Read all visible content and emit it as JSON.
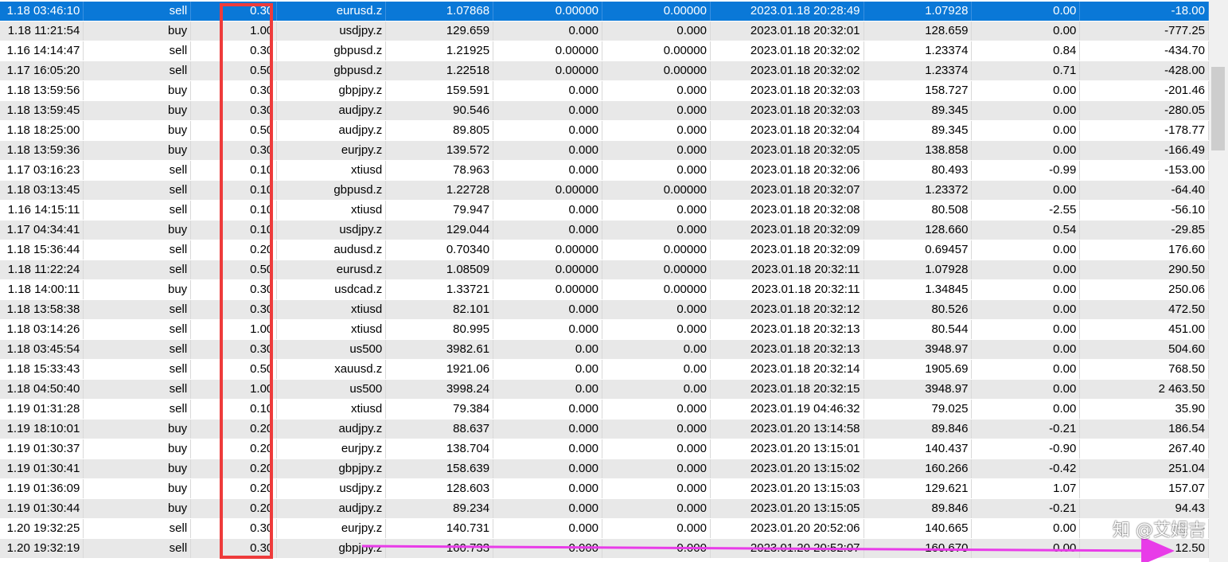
{
  "table": {
    "rows": [
      {
        "open_time": "1.18 03:46:10",
        "type": "sell",
        "volume": "0.30",
        "symbol": "eurusd.z",
        "price": "1.07868",
        "sl": "0.00000",
        "tp": "0.00000",
        "close_time": "2023.01.18 20:28:49",
        "close_price": "1.07928",
        "swap": "0.00",
        "profit": "-18.00"
      },
      {
        "open_time": "1.18 11:21:54",
        "type": "buy",
        "volume": "1.00",
        "symbol": "usdjpy.z",
        "price": "129.659",
        "sl": "0.000",
        "tp": "0.000",
        "close_time": "2023.01.18 20:32:01",
        "close_price": "128.659",
        "swap": "0.00",
        "profit": "-777.25"
      },
      {
        "open_time": "1.16 14:14:47",
        "type": "sell",
        "volume": "0.30",
        "symbol": "gbpusd.z",
        "price": "1.21925",
        "sl": "0.00000",
        "tp": "0.00000",
        "close_time": "2023.01.18 20:32:02",
        "close_price": "1.23374",
        "swap": "0.84",
        "profit": "-434.70"
      },
      {
        "open_time": "1.17 16:05:20",
        "type": "sell",
        "volume": "0.50",
        "symbol": "gbpusd.z",
        "price": "1.22518",
        "sl": "0.00000",
        "tp": "0.00000",
        "close_time": "2023.01.18 20:32:02",
        "close_price": "1.23374",
        "swap": "0.71",
        "profit": "-428.00"
      },
      {
        "open_time": "1.18 13:59:56",
        "type": "buy",
        "volume": "0.30",
        "symbol": "gbpjpy.z",
        "price": "159.591",
        "sl": "0.000",
        "tp": "0.000",
        "close_time": "2023.01.18 20:32:03",
        "close_price": "158.727",
        "swap": "0.00",
        "profit": "-201.46"
      },
      {
        "open_time": "1.18 13:59:45",
        "type": "buy",
        "volume": "0.30",
        "symbol": "audjpy.z",
        "price": "90.546",
        "sl": "0.000",
        "tp": "0.000",
        "close_time": "2023.01.18 20:32:03",
        "close_price": "89.345",
        "swap": "0.00",
        "profit": "-280.05"
      },
      {
        "open_time": "1.18 18:25:00",
        "type": "buy",
        "volume": "0.50",
        "symbol": "audjpy.z",
        "price": "89.805",
        "sl": "0.000",
        "tp": "0.000",
        "close_time": "2023.01.18 20:32:04",
        "close_price": "89.345",
        "swap": "0.00",
        "profit": "-178.77"
      },
      {
        "open_time": "1.18 13:59:36",
        "type": "buy",
        "volume": "0.30",
        "symbol": "eurjpy.z",
        "price": "139.572",
        "sl": "0.000",
        "tp": "0.000",
        "close_time": "2023.01.18 20:32:05",
        "close_price": "138.858",
        "swap": "0.00",
        "profit": "-166.49"
      },
      {
        "open_time": "1.17 03:16:23",
        "type": "sell",
        "volume": "0.10",
        "symbol": "xtiusd",
        "price": "78.963",
        "sl": "0.000",
        "tp": "0.000",
        "close_time": "2023.01.18 20:32:06",
        "close_price": "80.493",
        "swap": "-0.99",
        "profit": "-153.00"
      },
      {
        "open_time": "1.18 03:13:45",
        "type": "sell",
        "volume": "0.10",
        "symbol": "gbpusd.z",
        "price": "1.22728",
        "sl": "0.00000",
        "tp": "0.00000",
        "close_time": "2023.01.18 20:32:07",
        "close_price": "1.23372",
        "swap": "0.00",
        "profit": "-64.40"
      },
      {
        "open_time": "1.16 14:15:11",
        "type": "sell",
        "volume": "0.10",
        "symbol": "xtiusd",
        "price": "79.947",
        "sl": "0.000",
        "tp": "0.000",
        "close_time": "2023.01.18 20:32:08",
        "close_price": "80.508",
        "swap": "-2.55",
        "profit": "-56.10"
      },
      {
        "open_time": "1.17 04:34:41",
        "type": "buy",
        "volume": "0.10",
        "symbol": "usdjpy.z",
        "price": "129.044",
        "sl": "0.000",
        "tp": "0.000",
        "close_time": "2023.01.18 20:32:09",
        "close_price": "128.660",
        "swap": "0.54",
        "profit": "-29.85"
      },
      {
        "open_time": "1.18 15:36:44",
        "type": "sell",
        "volume": "0.20",
        "symbol": "audusd.z",
        "price": "0.70340",
        "sl": "0.00000",
        "tp": "0.00000",
        "close_time": "2023.01.18 20:32:09",
        "close_price": "0.69457",
        "swap": "0.00",
        "profit": "176.60"
      },
      {
        "open_time": "1.18 11:22:24",
        "type": "sell",
        "volume": "0.50",
        "symbol": "eurusd.z",
        "price": "1.08509",
        "sl": "0.00000",
        "tp": "0.00000",
        "close_time": "2023.01.18 20:32:11",
        "close_price": "1.07928",
        "swap": "0.00",
        "profit": "290.50"
      },
      {
        "open_time": "1.18 14:00:11",
        "type": "buy",
        "volume": "0.30",
        "symbol": "usdcad.z",
        "price": "1.33721",
        "sl": "0.00000",
        "tp": "0.00000",
        "close_time": "2023.01.18 20:32:11",
        "close_price": "1.34845",
        "swap": "0.00",
        "profit": "250.06"
      },
      {
        "open_time": "1.18 13:58:38",
        "type": "sell",
        "volume": "0.30",
        "symbol": "xtiusd",
        "price": "82.101",
        "sl": "0.000",
        "tp": "0.000",
        "close_time": "2023.01.18 20:32:12",
        "close_price": "80.526",
        "swap": "0.00",
        "profit": "472.50"
      },
      {
        "open_time": "1.18 03:14:26",
        "type": "sell",
        "volume": "1.00",
        "symbol": "xtiusd",
        "price": "80.995",
        "sl": "0.000",
        "tp": "0.000",
        "close_time": "2023.01.18 20:32:13",
        "close_price": "80.544",
        "swap": "0.00",
        "profit": "451.00"
      },
      {
        "open_time": "1.18 03:45:54",
        "type": "sell",
        "volume": "0.30",
        "symbol": "us500",
        "price": "3982.61",
        "sl": "0.00",
        "tp": "0.00",
        "close_time": "2023.01.18 20:32:13",
        "close_price": "3948.97",
        "swap": "0.00",
        "profit": "504.60"
      },
      {
        "open_time": "1.18 15:33:43",
        "type": "sell",
        "volume": "0.50",
        "symbol": "xauusd.z",
        "price": "1921.06",
        "sl": "0.00",
        "tp": "0.00",
        "close_time": "2023.01.18 20:32:14",
        "close_price": "1905.69",
        "swap": "0.00",
        "profit": "768.50"
      },
      {
        "open_time": "1.18 04:50:40",
        "type": "sell",
        "volume": "1.00",
        "symbol": "us500",
        "price": "3998.24",
        "sl": "0.00",
        "tp": "0.00",
        "close_time": "2023.01.18 20:32:15",
        "close_price": "3948.97",
        "swap": "0.00",
        "profit": "2 463.50"
      },
      {
        "open_time": "1.19 01:31:28",
        "type": "sell",
        "volume": "0.10",
        "symbol": "xtiusd",
        "price": "79.384",
        "sl": "0.000",
        "tp": "0.000",
        "close_time": "2023.01.19 04:46:32",
        "close_price": "79.025",
        "swap": "0.00",
        "profit": "35.90"
      },
      {
        "open_time": "1.19 18:10:01",
        "type": "buy",
        "volume": "0.20",
        "symbol": "audjpy.z",
        "price": "88.637",
        "sl": "0.000",
        "tp": "0.000",
        "close_time": "2023.01.20 13:14:58",
        "close_price": "89.846",
        "swap": "-0.21",
        "profit": "186.54"
      },
      {
        "open_time": "1.19 01:30:37",
        "type": "buy",
        "volume": "0.20",
        "symbol": "eurjpy.z",
        "price": "138.704",
        "sl": "0.000",
        "tp": "0.000",
        "close_time": "2023.01.20 13:15:01",
        "close_price": "140.437",
        "swap": "-0.90",
        "profit": "267.40"
      },
      {
        "open_time": "1.19 01:30:41",
        "type": "buy",
        "volume": "0.20",
        "symbol": "gbpjpy.z",
        "price": "158.639",
        "sl": "0.000",
        "tp": "0.000",
        "close_time": "2023.01.20 13:15:02",
        "close_price": "160.266",
        "swap": "-0.42",
        "profit": "251.04"
      },
      {
        "open_time": "1.19 01:36:09",
        "type": "buy",
        "volume": "0.20",
        "symbol": "usdjpy.z",
        "price": "128.603",
        "sl": "0.000",
        "tp": "0.000",
        "close_time": "2023.01.20 13:15:03",
        "close_price": "129.621",
        "swap": "1.07",
        "profit": "157.07"
      },
      {
        "open_time": "1.19 01:30:44",
        "type": "buy",
        "volume": "0.20",
        "symbol": "audjpy.z",
        "price": "89.234",
        "sl": "0.000",
        "tp": "0.000",
        "close_time": "2023.01.20 13:15:05",
        "close_price": "89.846",
        "swap": "-0.21",
        "profit": "94.43"
      },
      {
        "open_time": "1.20 19:32:25",
        "type": "sell",
        "volume": "0.30",
        "symbol": "eurjpy.z",
        "price": "140.731",
        "sl": "0.000",
        "tp": "0.000",
        "close_time": "2023.01.20 20:52:06",
        "close_price": "140.665",
        "swap": "0.00",
        "profit": "-"
      },
      {
        "open_time": "1.20 19:32:19",
        "type": "sell",
        "volume": "0.30",
        "symbol": "gbpjpy.z",
        "price": "160.733",
        "sl": "0.000",
        "tp": "0.000",
        "close_time": "2023.01.20 20:52:07",
        "close_price": "160.670",
        "swap": "0.00",
        "profit": "12.50"
      }
    ]
  },
  "selected_row": 0,
  "annotations": {
    "highlight_color": "#ee3b3b",
    "arrow_color": "#e83ce8",
    "watermark": "知 @艾姆吉"
  }
}
